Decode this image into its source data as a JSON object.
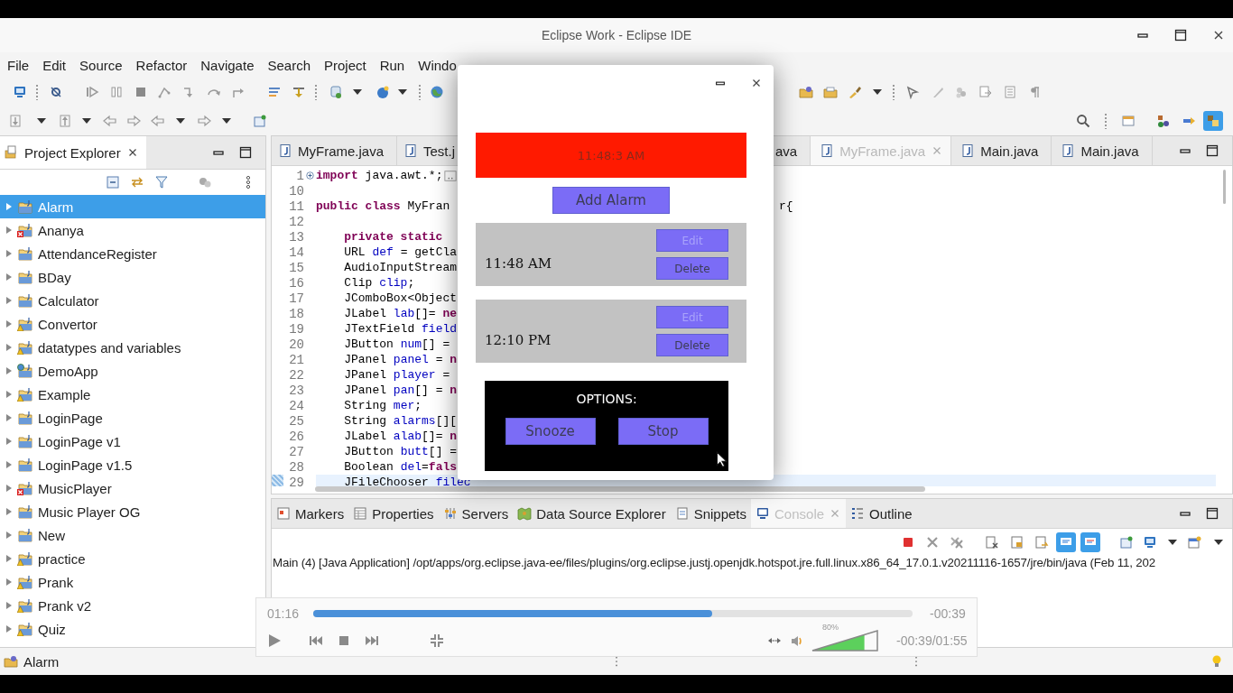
{
  "window": {
    "title": "Eclipse Work - Eclipse IDE"
  },
  "menu": [
    "File",
    "Edit",
    "Source",
    "Refactor",
    "Navigate",
    "Search",
    "Project",
    "Run",
    "Windo"
  ],
  "project_explorer": {
    "tab": {
      "label": "Project Explorer",
      "selected": true
    },
    "items": [
      {
        "label": "Alarm",
        "kind": "plain",
        "selected": true
      },
      {
        "label": "Ananya",
        "kind": "error",
        "selected": false
      },
      {
        "label": "AttendanceRegister",
        "kind": "plain",
        "selected": false
      },
      {
        "label": "BDay",
        "kind": "plain",
        "selected": false
      },
      {
        "label": "Calculator",
        "kind": "plain",
        "selected": false
      },
      {
        "label": "Convertor",
        "kind": "warning",
        "selected": false
      },
      {
        "label": "datatypes and variables",
        "kind": "warning",
        "selected": false
      },
      {
        "label": "DemoApp",
        "kind": "web",
        "selected": false
      },
      {
        "label": "Example",
        "kind": "warning",
        "selected": false
      },
      {
        "label": "LoginPage",
        "kind": "plain",
        "selected": false
      },
      {
        "label": "LoginPage v1",
        "kind": "plain",
        "selected": false
      },
      {
        "label": "LoginPage v1.5",
        "kind": "plain",
        "selected": false
      },
      {
        "label": "MusicPlayer",
        "kind": "error",
        "selected": false
      },
      {
        "label": "Music Player OG",
        "kind": "plain",
        "selected": false
      },
      {
        "label": "New",
        "kind": "plain",
        "selected": false
      },
      {
        "label": "practice",
        "kind": "warning",
        "selected": false
      },
      {
        "label": "Prank",
        "kind": "warning",
        "selected": false
      },
      {
        "label": "Prank v2",
        "kind": "warning",
        "selected": false
      },
      {
        "label": "Quiz",
        "kind": "warning",
        "selected": false
      }
    ]
  },
  "editor": {
    "tabs": [
      {
        "label": "MyFrame.java",
        "file_icon": true,
        "selected": false
      },
      {
        "label": "Test.j",
        "file_icon": true,
        "selected": false
      },
      {
        "label": "ava",
        "file_icon": false,
        "selected": false
      },
      {
        "label": "MyFrame.java",
        "file_icon": true,
        "selected": true
      },
      {
        "label": "Main.java",
        "file_icon": true,
        "selected": false
      },
      {
        "label": "Main.java",
        "file_icon": true,
        "selected": false
      }
    ],
    "lines": [
      {
        "number": "1",
        "folded": true,
        "current": false,
        "tokens": [
          {
            "kind": "keyword",
            "text": "import"
          },
          {
            "kind": "plain",
            "text": " java.awt.*;"
          }
        ]
      },
      {
        "number": "10",
        "folded": false,
        "current": false
      },
      {
        "number": "11",
        "folded": false,
        "current": false,
        "tokens": [
          {
            "kind": "keyword",
            "text": "public class"
          },
          {
            "kind": "plain",
            "text": " MyFran"
          }
        ],
        "tail": "r{"
      },
      {
        "number": "12",
        "folded": false,
        "current": false
      },
      {
        "number": "13",
        "folded": false,
        "current": false,
        "tokens": [
          {
            "kind": "keyword",
            "text": "    private static"
          }
        ]
      },
      {
        "number": "14",
        "folded": false,
        "current": false,
        "tokens": [
          {
            "kind": "plain",
            "text": "    URL "
          },
          {
            "kind": "field",
            "text": "def"
          },
          {
            "kind": "plain",
            "text": " = getCla"
          }
        ]
      },
      {
        "number": "15",
        "folded": false,
        "current": false,
        "tokens": [
          {
            "kind": "plain",
            "text": "    AudioInputStream"
          }
        ]
      },
      {
        "number": "16",
        "folded": false,
        "current": false,
        "tokens": [
          {
            "kind": "plain",
            "text": "    Clip "
          },
          {
            "kind": "field",
            "text": "clip"
          },
          {
            "kind": "plain",
            "text": ";"
          }
        ]
      },
      {
        "number": "17",
        "folded": false,
        "current": false,
        "tokens": [
          {
            "kind": "plain",
            "text": "    JComboBox<Object"
          }
        ]
      },
      {
        "number": "18",
        "folded": false,
        "current": false,
        "tokens": [
          {
            "kind": "plain",
            "text": "    JLabel "
          },
          {
            "kind": "field",
            "text": "lab"
          },
          {
            "kind": "plain",
            "text": "[]= "
          },
          {
            "kind": "keyword",
            "text": "ne"
          }
        ]
      },
      {
        "number": "19",
        "folded": false,
        "current": false,
        "tokens": [
          {
            "kind": "plain",
            "text": "    JTextField "
          },
          {
            "kind": "field",
            "text": "field"
          }
        ]
      },
      {
        "number": "20",
        "folded": false,
        "current": false,
        "tokens": [
          {
            "kind": "plain",
            "text": "    JButton "
          },
          {
            "kind": "field",
            "text": "num"
          },
          {
            "kind": "plain",
            "text": "[] ="
          }
        ]
      },
      {
        "number": "21",
        "folded": false,
        "current": false,
        "tokens": [
          {
            "kind": "plain",
            "text": "    JPanel "
          },
          {
            "kind": "field",
            "text": "panel"
          },
          {
            "kind": "plain",
            "text": " = "
          },
          {
            "kind": "keyword",
            "text": "n"
          }
        ]
      },
      {
        "number": "22",
        "folded": false,
        "current": false,
        "tokens": [
          {
            "kind": "plain",
            "text": "    JPanel "
          },
          {
            "kind": "field",
            "text": "player"
          },
          {
            "kind": "plain",
            "text": " ="
          }
        ]
      },
      {
        "number": "23",
        "folded": false,
        "current": false,
        "tokens": [
          {
            "kind": "plain",
            "text": "    JPanel "
          },
          {
            "kind": "field",
            "text": "pan"
          },
          {
            "kind": "plain",
            "text": "[] = "
          },
          {
            "kind": "keyword",
            "text": "n"
          }
        ]
      },
      {
        "number": "24",
        "folded": false,
        "current": false,
        "tokens": [
          {
            "kind": "plain",
            "text": "    String "
          },
          {
            "kind": "field",
            "text": "mer"
          },
          {
            "kind": "plain",
            "text": ";"
          }
        ]
      },
      {
        "number": "25",
        "folded": false,
        "current": false,
        "tokens": [
          {
            "kind": "plain",
            "text": "    String "
          },
          {
            "kind": "field",
            "text": "alarms"
          },
          {
            "kind": "plain",
            "text": "[]["
          }
        ]
      },
      {
        "number": "26",
        "folded": false,
        "current": false,
        "tokens": [
          {
            "kind": "plain",
            "text": "    JLabel "
          },
          {
            "kind": "field",
            "text": "alab"
          },
          {
            "kind": "plain",
            "text": "[]= "
          },
          {
            "kind": "keyword",
            "text": "n"
          }
        ]
      },
      {
        "number": "27",
        "folded": false,
        "current": false,
        "tokens": [
          {
            "kind": "plain",
            "text": "    JButton "
          },
          {
            "kind": "field",
            "text": "butt"
          },
          {
            "kind": "plain",
            "text": "[] ="
          }
        ]
      },
      {
        "number": "28",
        "folded": false,
        "current": false,
        "tokens": [
          {
            "kind": "plain",
            "text": "    Boolean "
          },
          {
            "kind": "field",
            "text": "del"
          },
          {
            "kind": "plain",
            "text": "="
          },
          {
            "kind": "keyword",
            "text": "fals"
          }
        ]
      },
      {
        "number": "29",
        "folded": false,
        "current": true,
        "tokens": [
          {
            "kind": "plain",
            "text": "    JFileChooser "
          },
          {
            "kind": "field",
            "text": "filec"
          }
        ]
      }
    ]
  },
  "bottom_panel": {
    "tabs": [
      {
        "label": "Markers",
        "selected": false
      },
      {
        "label": "Properties",
        "selected": false
      },
      {
        "label": "Servers",
        "selected": false
      },
      {
        "label": "Data Source Explorer",
        "selected": false
      },
      {
        "label": "Snippets",
        "selected": false
      },
      {
        "label": "Console",
        "selected": true
      },
      {
        "label": "Outline",
        "selected": false
      }
    ],
    "console_text": "Main (4) [Java Application] /opt/apps/org.eclipse.java-ee/files/plugins/org.eclipse.justj.openjdk.hotspot.jre.full.linux.x86_64_17.0.1.v20211116-1657/jre/bin/java  (Feb 11, 202"
  },
  "status_bar": {
    "text": "Alarm"
  },
  "alarm_dialog": {
    "clock": "11:48:3 AM",
    "add_button": "Add Alarm",
    "alarms": [
      {
        "time": "11:48 AM",
        "buttons": [
          {
            "label": "Edit",
            "disabled": true
          },
          {
            "label": "Delete",
            "disabled": false
          }
        ]
      },
      {
        "time": "12:10 PM",
        "buttons": [
          {
            "label": "Edit",
            "disabled": true
          },
          {
            "label": "Delete",
            "disabled": false
          }
        ]
      }
    ],
    "options": {
      "title": "OPTIONS:",
      "buttons": [
        "Snooze",
        "Stop"
      ]
    }
  },
  "media_player": {
    "elapsed": "01:16",
    "remaining": "-00:39",
    "level": 0.666,
    "volume": {
      "level": 0.8,
      "reading": "80%"
    },
    "time": "-00:39/01:55"
  }
}
